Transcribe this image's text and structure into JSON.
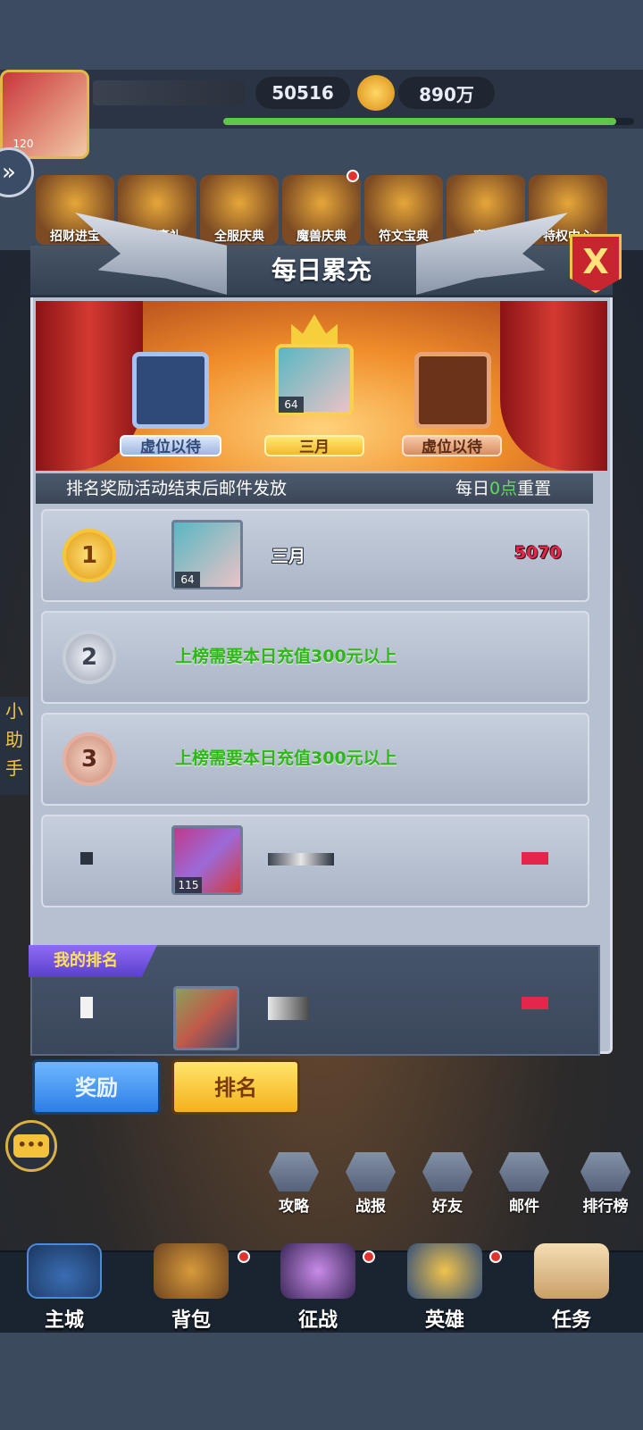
{
  "resources": {
    "stamina": "50516",
    "gold": "890万",
    "player_level": "120"
  },
  "events": [
    {
      "label": "招财进宝"
    },
    {
      "label": "全服豪礼"
    },
    {
      "label": "全服庆典"
    },
    {
      "label": "魔兽庆典"
    },
    {
      "label": "符文宝典"
    },
    {
      "label": "赛季"
    },
    {
      "label": "特权中心"
    }
  ],
  "modal": {
    "title": "每日累充",
    "close_label": "X"
  },
  "stage": {
    "slot1_label": "三月",
    "slot1_level": "64",
    "slot2_label": "虚位以待",
    "slot3_label": "虚位以待"
  },
  "info": {
    "notice": "排名奖励活动结束后邮件发放",
    "reset_prefix": "每日",
    "reset_highlight": "0点",
    "reset_suffix": "重置"
  },
  "ranks": [
    {
      "medal": "1",
      "name": "三月",
      "level": "64",
      "score": "5070"
    },
    {
      "medal": "2",
      "requirement": "上榜需要本日充值300元以上"
    },
    {
      "medal": "3",
      "requirement": "上榜需要本日充值300元以上"
    },
    {
      "level": "115"
    }
  ],
  "my_rank": {
    "tag": "我的排名"
  },
  "tabs": {
    "reward": "奖励",
    "rank": "排名"
  },
  "chat_label": "•••",
  "side_helper": "小助手",
  "quick_links": [
    {
      "label": "攻略"
    },
    {
      "label": "战报"
    },
    {
      "label": "好友"
    },
    {
      "label": "邮件"
    },
    {
      "label": "排行榜"
    }
  ],
  "bottom_nav": [
    {
      "label": "主城"
    },
    {
      "label": "背包"
    },
    {
      "label": "征战"
    },
    {
      "label": "英雄"
    },
    {
      "label": "任务"
    }
  ],
  "colors": {
    "accent_green": "#5fdc5a",
    "score_red": "#e4264a",
    "requirement_green": "#2fb71a"
  }
}
